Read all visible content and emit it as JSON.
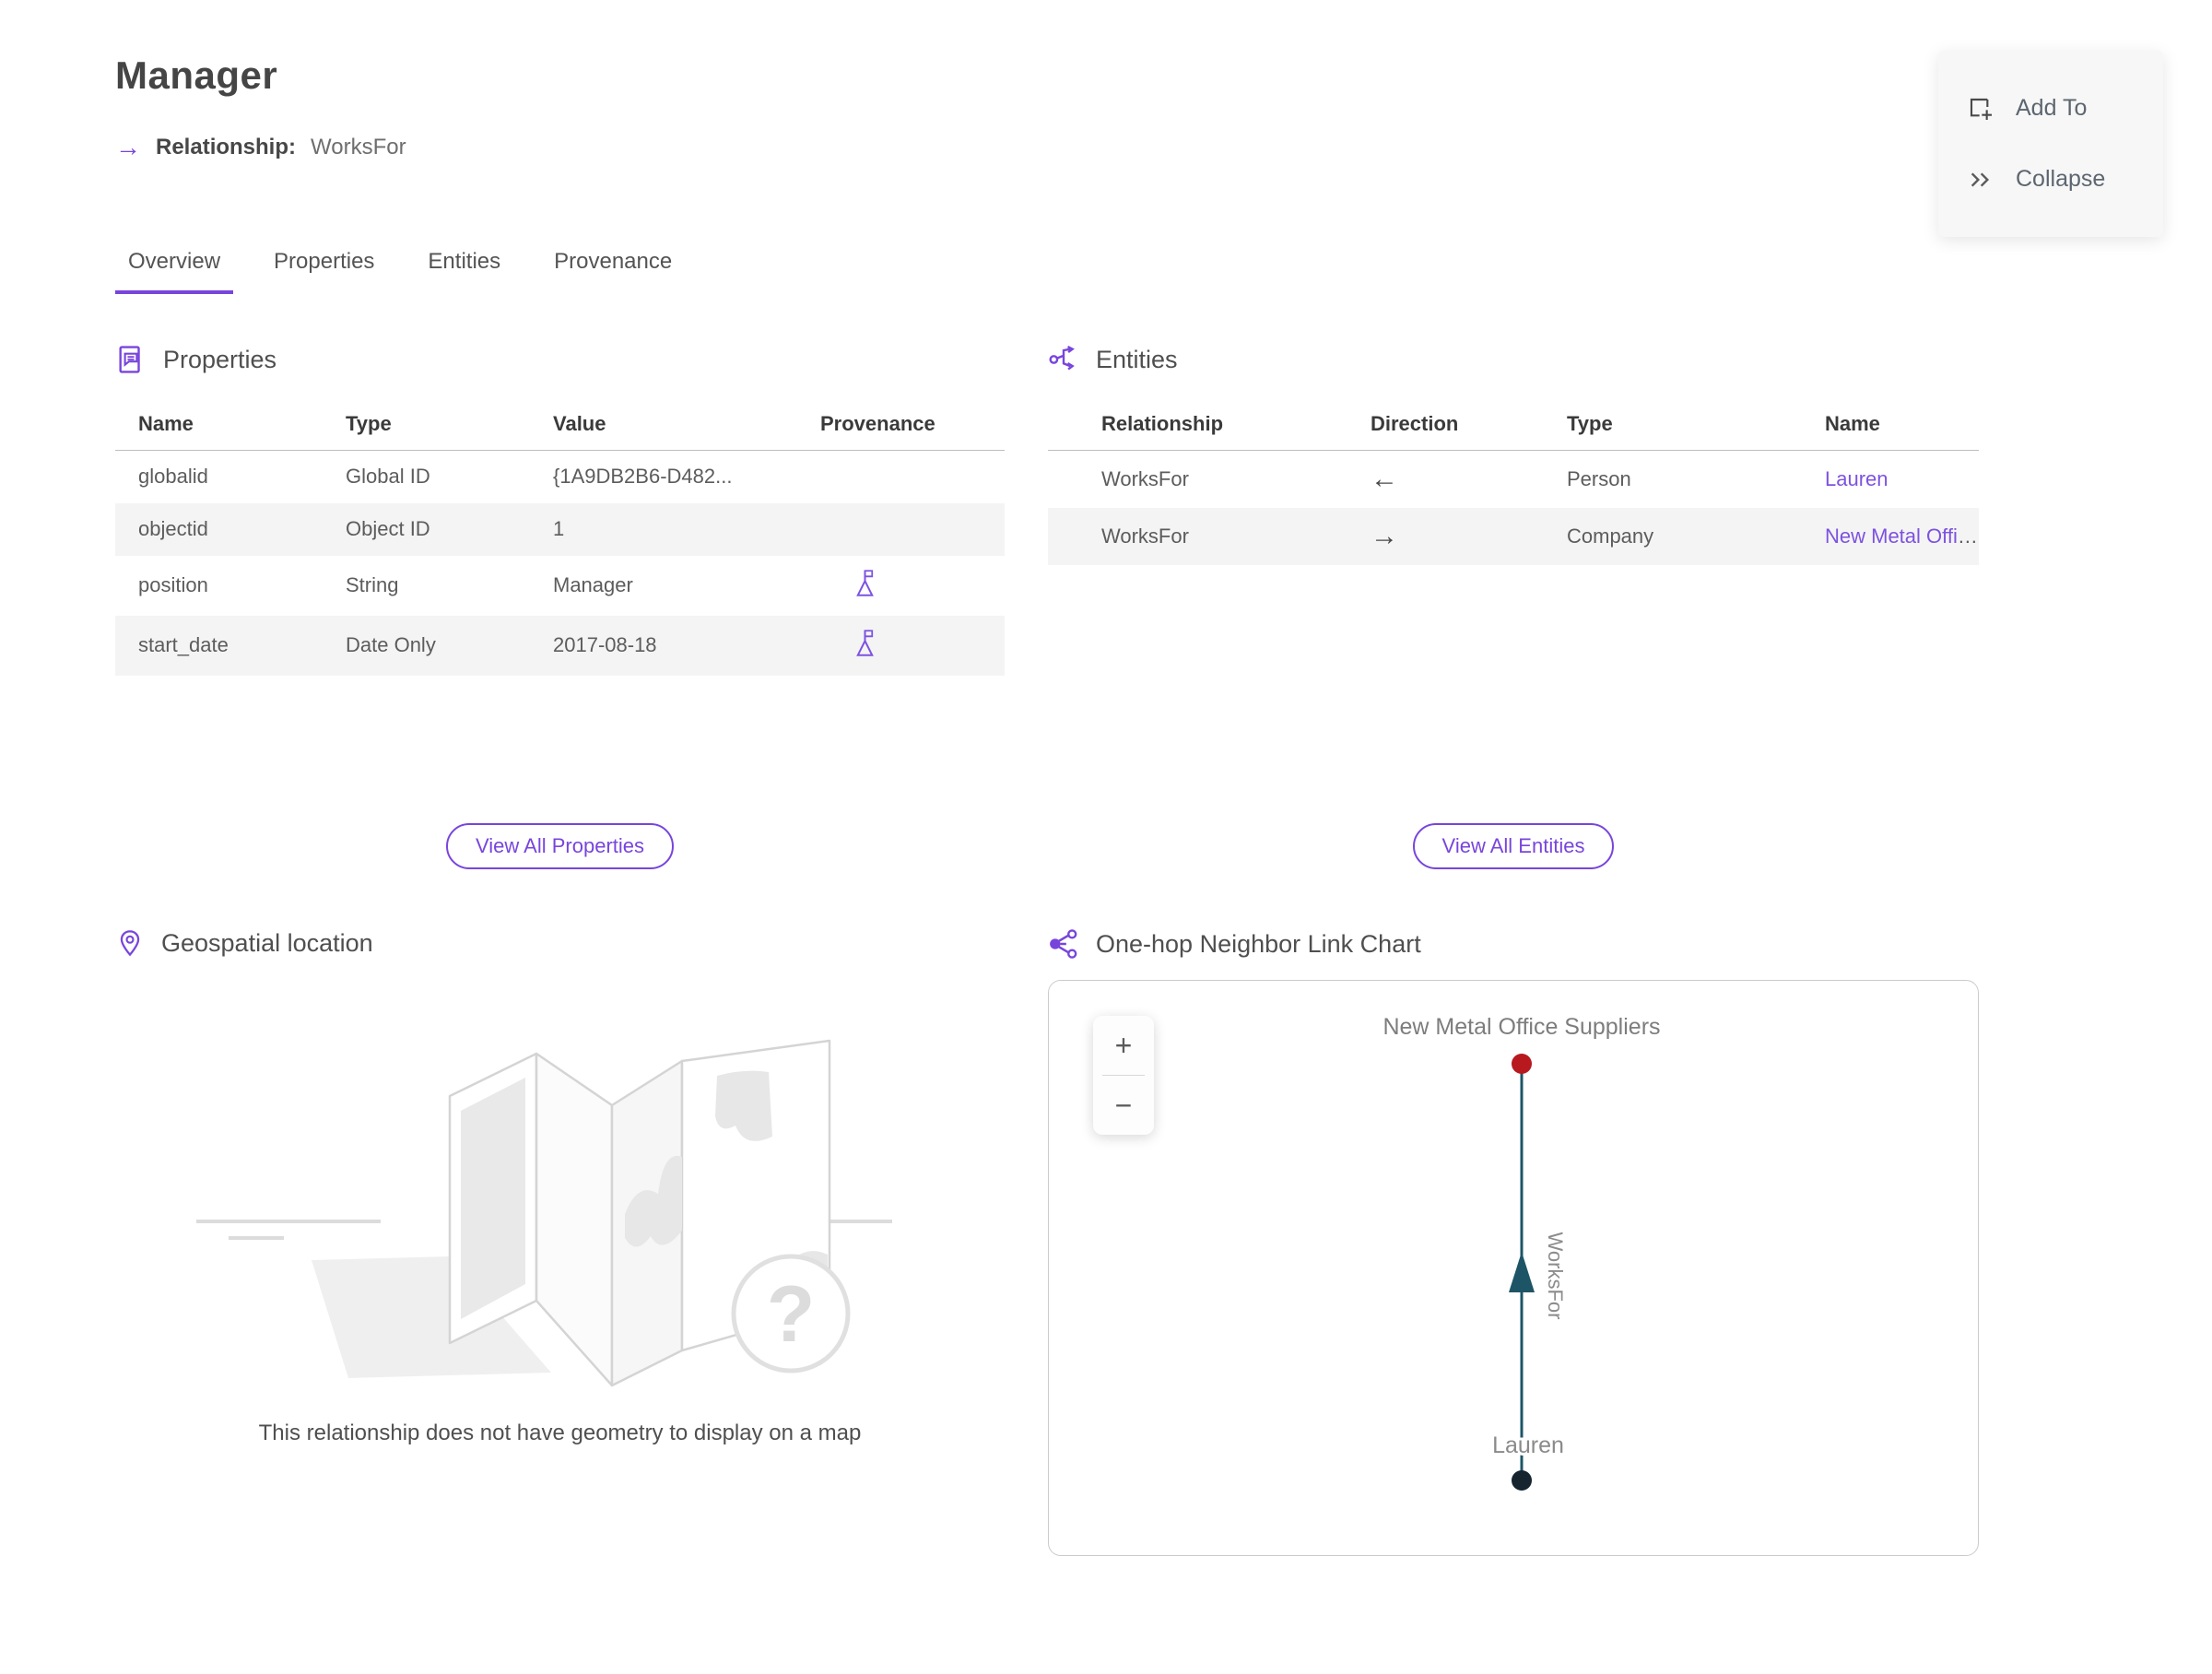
{
  "header": {
    "title": "Manager",
    "subtitle_icon": "→",
    "subtitle_label": "Relationship:",
    "subtitle_value": "WorksFor",
    "actions": {
      "add_to": "Add To",
      "collapse": "Collapse"
    }
  },
  "tabs": [
    {
      "label": "Overview",
      "active": true
    },
    {
      "label": "Properties",
      "active": false
    },
    {
      "label": "Entities",
      "active": false
    },
    {
      "label": "Provenance",
      "active": false
    }
  ],
  "properties_section": {
    "title": "Properties",
    "columns": {
      "name": "Name",
      "type": "Type",
      "value": "Value",
      "provenance": "Provenance"
    },
    "rows": [
      {
        "name": "globalid",
        "type": "Global ID",
        "value": "{1A9DB2B6-D482...",
        "has_provenance": false
      },
      {
        "name": "objectid",
        "type": "Object ID",
        "value": "1",
        "has_provenance": false
      },
      {
        "name": "position",
        "type": "String",
        "value": "Manager",
        "has_provenance": true
      },
      {
        "name": "start_date",
        "type": "Date Only",
        "value": "2017-08-18",
        "has_provenance": true
      }
    ],
    "view_all_label": "View All Properties"
  },
  "entities_section": {
    "title": "Entities",
    "columns": {
      "relationship": "Relationship",
      "direction": "Direction",
      "type": "Type",
      "name": "Name"
    },
    "rows": [
      {
        "relationship": "WorksFor",
        "direction_glyph": "←",
        "type": "Person",
        "name": "Lauren"
      },
      {
        "relationship": "WorksFor",
        "direction_glyph": "→",
        "type": "Company",
        "name": "New Metal Offic..."
      }
    ],
    "view_all_label": "View All Entities"
  },
  "geospatial_section": {
    "title": "Geospatial location",
    "question_glyph": "?",
    "empty_message": "This relationship does not have geometry to display on a map"
  },
  "link_chart_section": {
    "title": "One-hop Neighbor Link Chart",
    "zoom_in_glyph": "+",
    "zoom_out_glyph": "−",
    "chart_data": {
      "type": "node-link-graph",
      "nodes": [
        {
          "id": "company",
          "label": "New Metal Office Suppliers",
          "color": "#b7191f",
          "position": "top"
        },
        {
          "id": "person",
          "label": "Lauren",
          "color": "#16242f",
          "position": "bottom"
        }
      ],
      "edges": [
        {
          "from": "person",
          "to": "company",
          "label": "WorksFor",
          "direction": "up",
          "color": "#1d5566"
        }
      ]
    }
  },
  "colors": {
    "accent_purple": "#7845dc",
    "link_purple": "#7d52e0",
    "edge_teal": "#1d5566",
    "node_red": "#b7191f",
    "node_dark": "#16242f",
    "row_stripe": "#f4f4f4"
  }
}
